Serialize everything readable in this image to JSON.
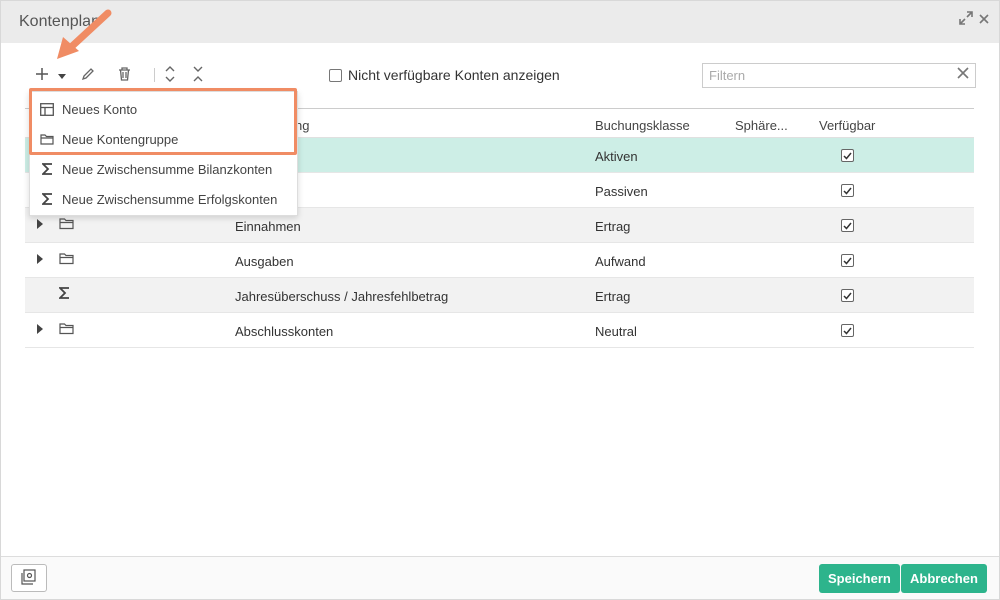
{
  "window": {
    "title": "Kontenplan",
    "expand_icon": "expand-icon",
    "close_icon": "close-icon"
  },
  "toolbar": {
    "add_icon": "plus-icon",
    "add_dropdown_icon": "caret-down-icon",
    "edit_icon": "pencil-icon",
    "delete_icon": "trash-icon",
    "expand_all_icon": "expand-all-icon",
    "collapse_all_icon": "collapse-all-icon",
    "show_unavailable_label": "Nicht verfügbare Konten anzeigen",
    "show_unavailable_checked": false,
    "filter_placeholder": "Filtern",
    "filter_value": ""
  },
  "add_menu": {
    "items": [
      {
        "label": "Neues Konto",
        "icon": "table-icon"
      },
      {
        "label": "Neue Kontengruppe",
        "icon": "folder-icon"
      },
      {
        "label": "Neue Zwischensumme Bilanzkonten",
        "icon": "sigma-icon"
      },
      {
        "label": "Neue Zwischensumme Erfolgskonten",
        "icon": "sigma-icon"
      }
    ]
  },
  "grid": {
    "columns": [
      "ng",
      "Buchungsklasse",
      "Sphäre...",
      "Verfügbar"
    ],
    "rows": [
      {
        "name": "",
        "klasse": "Aktiven",
        "icon": "",
        "expandable": false,
        "verfuegbar": true,
        "selected": true
      },
      {
        "name": "",
        "klasse": "Passiven",
        "icon": "",
        "expandable": false,
        "verfuegbar": true,
        "selected": false
      },
      {
        "name": "Einnahmen",
        "klasse": "Ertrag",
        "icon": "folder-icon",
        "expandable": true,
        "verfuegbar": true,
        "selected": false
      },
      {
        "name": "Ausgaben",
        "klasse": "Aufwand",
        "icon": "folder-icon",
        "expandable": true,
        "verfuegbar": true,
        "selected": false
      },
      {
        "name": "Jahresüberschuss / Jahresfehlbetrag",
        "klasse": "Ertrag",
        "icon": "sigma-icon",
        "expandable": false,
        "verfuegbar": true,
        "selected": false
      },
      {
        "name": "Abschlusskonten",
        "klasse": "Neutral",
        "icon": "folder-icon",
        "expandable": true,
        "verfuegbar": true,
        "selected": false
      }
    ]
  },
  "footer": {
    "settings_icon": "settings-icon",
    "save_label": "Speichern",
    "cancel_label": "Abbrechen"
  },
  "colors": {
    "accent": "#2db48c",
    "selected_row": "#cdeee6",
    "highlight": "#f08c64"
  }
}
